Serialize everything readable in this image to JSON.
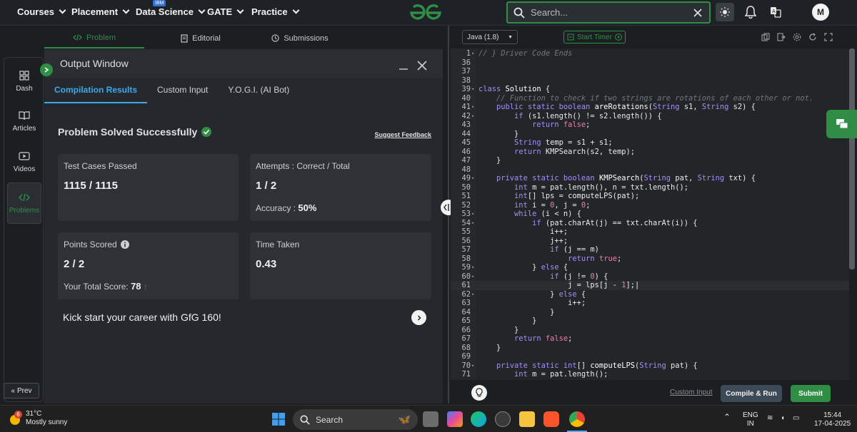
{
  "nav": {
    "items": [
      "Courses",
      "Placement",
      "Data Science",
      "GATE",
      "Practice"
    ],
    "ibm_badge": "IBM",
    "search_placeholder": "Search...",
    "avatar_initial": "M"
  },
  "sidebar": {
    "items": [
      {
        "label": "Dash",
        "icon": "dashboard-icon"
      },
      {
        "label": "Articles",
        "icon": "book-icon"
      },
      {
        "label": "Videos",
        "icon": "video-icon"
      },
      {
        "label": "Problems",
        "icon": "code-icon"
      }
    ],
    "prev_label": "Prev"
  },
  "tabs": [
    {
      "label": "Problem",
      "icon": "code-icon"
    },
    {
      "label": "Editorial",
      "icon": "document-icon"
    },
    {
      "label": "Submissions",
      "icon": "clock-icon"
    }
  ],
  "output": {
    "title": "Output Window",
    "tabs": [
      "Compilation Results",
      "Custom Input",
      "Y.O.G.I. (AI Bot)"
    ],
    "status": "Problem Solved Successfully",
    "feedback_link": "Suggest Feedback",
    "test_cases_label": "Test Cases Passed",
    "test_cases_value": "1115 / 1115",
    "attempts_label": "Attempts : Correct / Total",
    "attempts_value": "1 / 2",
    "accuracy_label": "Accuracy :",
    "accuracy_value": "50%",
    "points_label": "Points Scored",
    "points_value": "2 / 2",
    "total_score_label": "Your Total Score:",
    "total_score_value": "78",
    "time_label": "Time Taken",
    "time_value": "0.43",
    "kick_start": "Kick start your career with GfG 160!"
  },
  "editor": {
    "language": "Java (1.8)",
    "timer_label": "Start Timer",
    "custom_input_link": "Custom Input",
    "compile_button": "Compile & Run",
    "submit_button": "Submit",
    "current_line": 61,
    "lines": [
      {
        "n": "1",
        "html": "<span class=\"c\">// } Driver Code Ends</span>",
        "fold": true
      },
      {
        "n": "36",
        "html": ""
      },
      {
        "n": "37",
        "html": ""
      },
      {
        "n": "38",
        "html": ""
      },
      {
        "n": "39",
        "html": "<span class=\"k\">class</span> <span class=\"f\">Solution</span> {",
        "fold": true
      },
      {
        "n": "40",
        "html": "    <span class=\"c\">// Function to check if two strings are rotations of each other or not.</span>"
      },
      {
        "n": "41",
        "html": "    <span class=\"k\">public static boolean</span> <span class=\"f\">areRotations</span>(<span class=\"k\">String</span> s1, <span class=\"k\">String</span> s2) {",
        "fold": true
      },
      {
        "n": "42",
        "html": "        <span class=\"k\">if</span> (s1.length() != s2.length()) {",
        "fold": true
      },
      {
        "n": "43",
        "html": "            <span class=\"k\">return</span> <span class=\"n\">false</span>;"
      },
      {
        "n": "44",
        "html": "        }"
      },
      {
        "n": "45",
        "html": "        <span class=\"k\">String</span> temp = s1 + s1;"
      },
      {
        "n": "46",
        "html": "        <span class=\"k\">return</span> KMPSearch(s2, temp);"
      },
      {
        "n": "47",
        "html": "    }"
      },
      {
        "n": "48",
        "html": ""
      },
      {
        "n": "49",
        "html": "    <span class=\"k\">private static boolean</span> <span class=\"f\">KMPSearch</span>(<span class=\"k\">String</span> pat, <span class=\"k\">String</span> txt) {",
        "fold": true
      },
      {
        "n": "50",
        "html": "        <span class=\"k\">int</span> m = pat.length(), n = txt.length();"
      },
      {
        "n": "51",
        "html": "        <span class=\"k\">int</span>[] lps = computeLPS(pat);"
      },
      {
        "n": "52",
        "html": "        <span class=\"k\">int</span> i = <span class=\"n\">0</span>, j = <span class=\"n\">0</span>;"
      },
      {
        "n": "53",
        "html": "        <span class=\"k\">while</span> (i &lt; n) {",
        "fold": true
      },
      {
        "n": "54",
        "html": "            <span class=\"k\">if</span> (pat.charAt(j) == txt.charAt(i)) {",
        "fold": true
      },
      {
        "n": "55",
        "html": "                i++;"
      },
      {
        "n": "56",
        "html": "                j++;"
      },
      {
        "n": "57",
        "html": "                <span class=\"k\">if</span> (j == m)"
      },
      {
        "n": "58",
        "html": "                    <span class=\"k\">return</span> <span class=\"n\">true</span>;"
      },
      {
        "n": "59",
        "html": "            } <span class=\"k\">else</span> {",
        "fold": true
      },
      {
        "n": "60",
        "html": "                <span class=\"k\">if</span> (j != <span class=\"n\">0</span>) {",
        "fold": true
      },
      {
        "n": "61",
        "html": "                    j = lps[j - <span class=\"n\">1</span>];|"
      },
      {
        "n": "62",
        "html": "                } <span class=\"k\">else</span> {",
        "fold": true
      },
      {
        "n": "63",
        "html": "                    i++;"
      },
      {
        "n": "64",
        "html": "                }"
      },
      {
        "n": "65",
        "html": "            }"
      },
      {
        "n": "66",
        "html": "        }"
      },
      {
        "n": "67",
        "html": "        <span class=\"k\">return</span> <span class=\"n\">false</span>;"
      },
      {
        "n": "68",
        "html": "    }"
      },
      {
        "n": "69",
        "html": ""
      },
      {
        "n": "70",
        "html": "    <span class=\"k\">private static int</span>[] <span class=\"f\">computeLPS</span>(<span class=\"k\">String</span> pat) {",
        "fold": true
      },
      {
        "n": "71",
        "html": "        <span class=\"k\">int</span> m = pat.length();"
      }
    ]
  },
  "taskbar": {
    "weather_badge": "6",
    "temperature": "31°C",
    "weather": "Mostly sunny",
    "search_label": "Search",
    "lang_line1": "ENG",
    "lang_line2": "IN",
    "time": "15:44",
    "date": "17-04-2025"
  },
  "colors": {
    "accent_green": "#2f8d46",
    "accent_blue": "#3da9e8",
    "background": "#1c1f22"
  }
}
